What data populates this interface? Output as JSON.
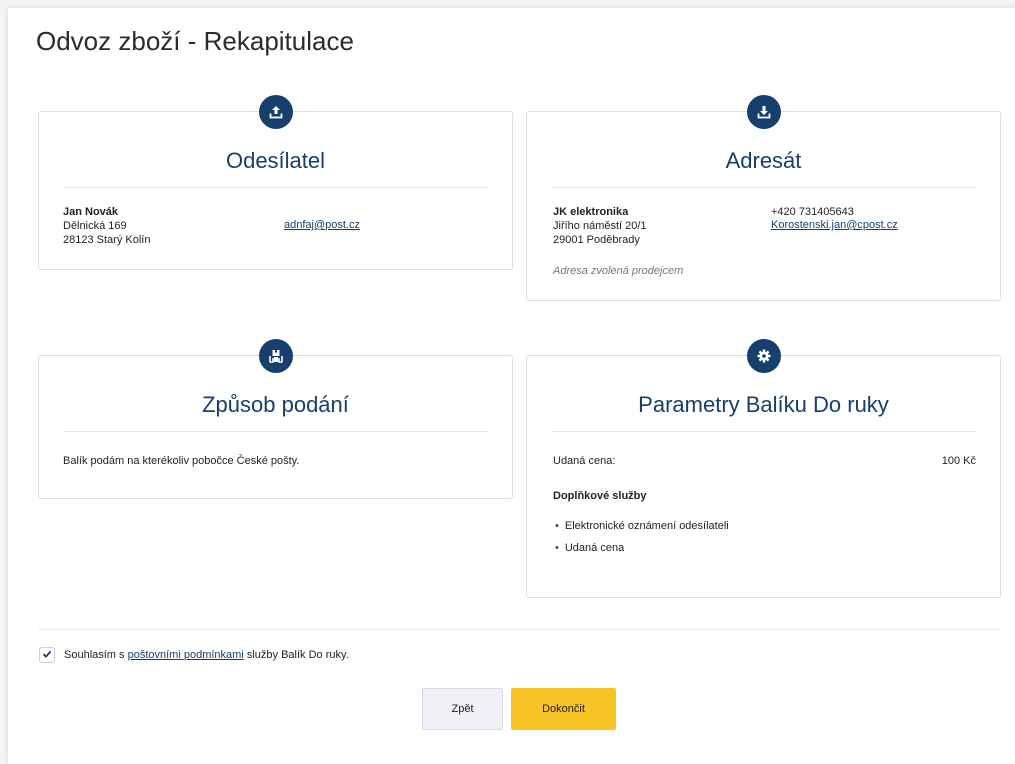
{
  "page": {
    "title": "Odvoz zboží - Rekapitulace"
  },
  "sender": {
    "heading": "Odesílatel",
    "icon": "upload-icon",
    "name": "Jan Novák",
    "street": "Dělnická 169",
    "city": "28123 Starý Kolín",
    "email": "adnfaj@post.cz"
  },
  "recipient": {
    "heading": "Adresát",
    "icon": "download-icon",
    "name": "JK elektronika",
    "street": "Jiřího náměstí 20/1",
    "city": "29001 Poděbrady",
    "phone": "+420 731405643",
    "email": "Korostenski.jan@cpost.cz",
    "note": "Adresa zvolená prodejcem"
  },
  "submission": {
    "heading": "Způsob podání",
    "icon": "parcel-hands-icon",
    "text": "Balík podám na kterékoliv pobočce České pošty."
  },
  "parameters": {
    "heading": "Parametry Balíku Do ruky",
    "icon": "gear-icon",
    "declared_price_label": "Udaná cena:",
    "declared_price_value": "100 Kč",
    "services_heading": "Doplňkové služby",
    "services": [
      "Elektronické oznámení odesílateli",
      "Udaná cena"
    ]
  },
  "consent": {
    "checked": true,
    "text_before": "Souhlasím s",
    "link": "poštovními podmínkami",
    "text_after": "služby Balík Do ruky."
  },
  "buttons": {
    "back": "Zpět",
    "finish": "Dokončit"
  },
  "colors": {
    "primary": "#163f6e",
    "accent": "#f7c327"
  }
}
